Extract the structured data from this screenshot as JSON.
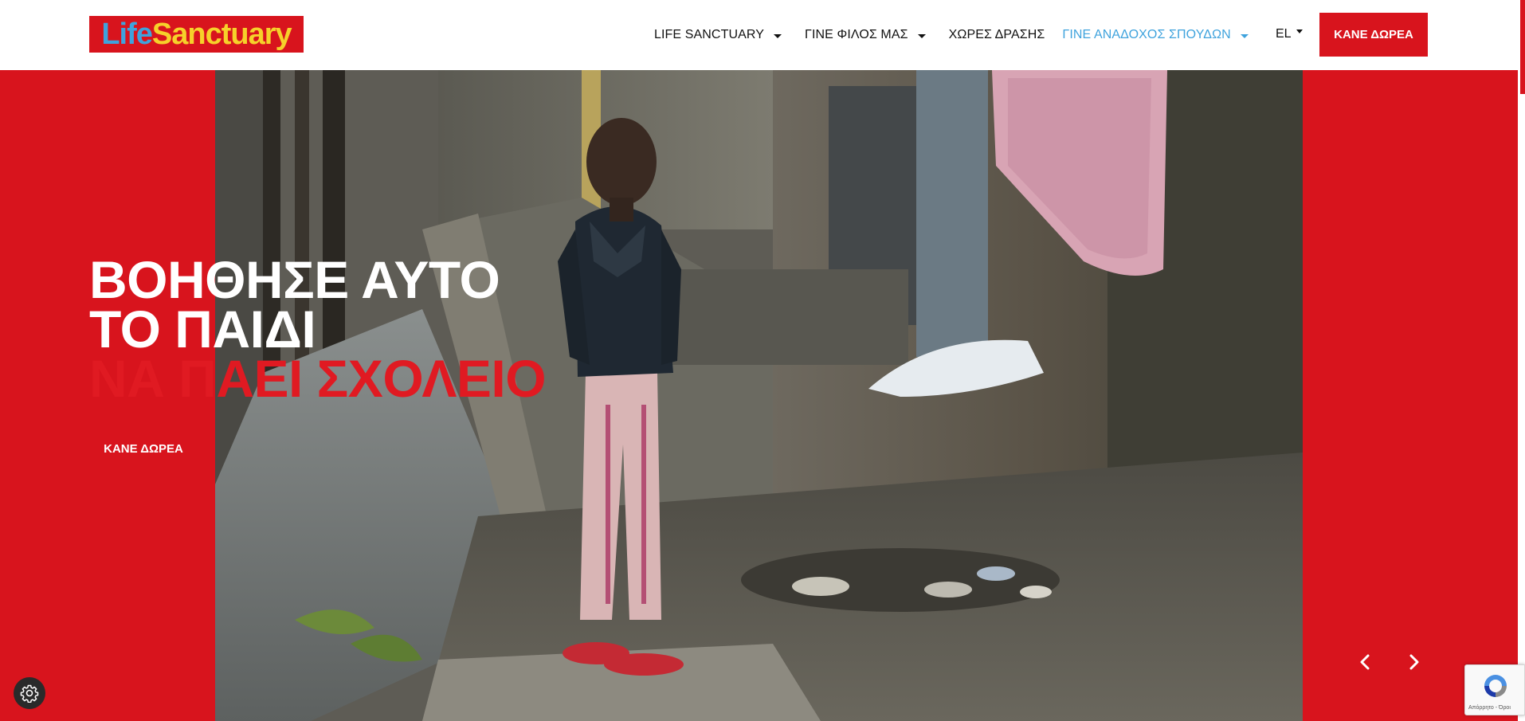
{
  "header": {
    "logo": {
      "part1": "Life",
      "part2": "Sanctuary"
    },
    "nav": [
      {
        "label": "LIFE SANCTUARY",
        "dropdown": true,
        "active": false
      },
      {
        "label": "ΓΙΝΕ ΦΙΛΟΣ ΜΑΣ",
        "dropdown": true,
        "active": false
      },
      {
        "label": "ΧΩΡΕΣ ΔΡΑΣΗΣ",
        "dropdown": false,
        "active": false
      },
      {
        "label": "ΓΙΝΕ ΑΝΑΔΟΧΟΣ ΣΠΟΥΔΩΝ",
        "dropdown": true,
        "active": true
      }
    ],
    "language": "EL",
    "donate_label": "ΚΑΝΕ ΔΩΡΕΑ"
  },
  "hero": {
    "title_line1": "ΒΟΗΘΗΣΕ ΑΥΤΟ",
    "title_line2": "ΤΟ ΠΑΙΔΙ",
    "title_line3": "ΝΑ ΠΑΕΙ ΣΧΟΛΕΙΟ",
    "donate_label": "ΚΑΝΕ ΔΩΡΕΑ",
    "prev_icon": "chevron-left-icon",
    "next_icon": "chevron-right-icon"
  },
  "cookie_settings_icon": "gear-icon",
  "recaptcha": {
    "footer": "Απόρρητο - Όροι"
  },
  "colors": {
    "brand_red": "#d8141d",
    "accent_blue": "#3fa3dd",
    "logo_yellow": "#f6d12a",
    "title_red": "#e01a22"
  }
}
